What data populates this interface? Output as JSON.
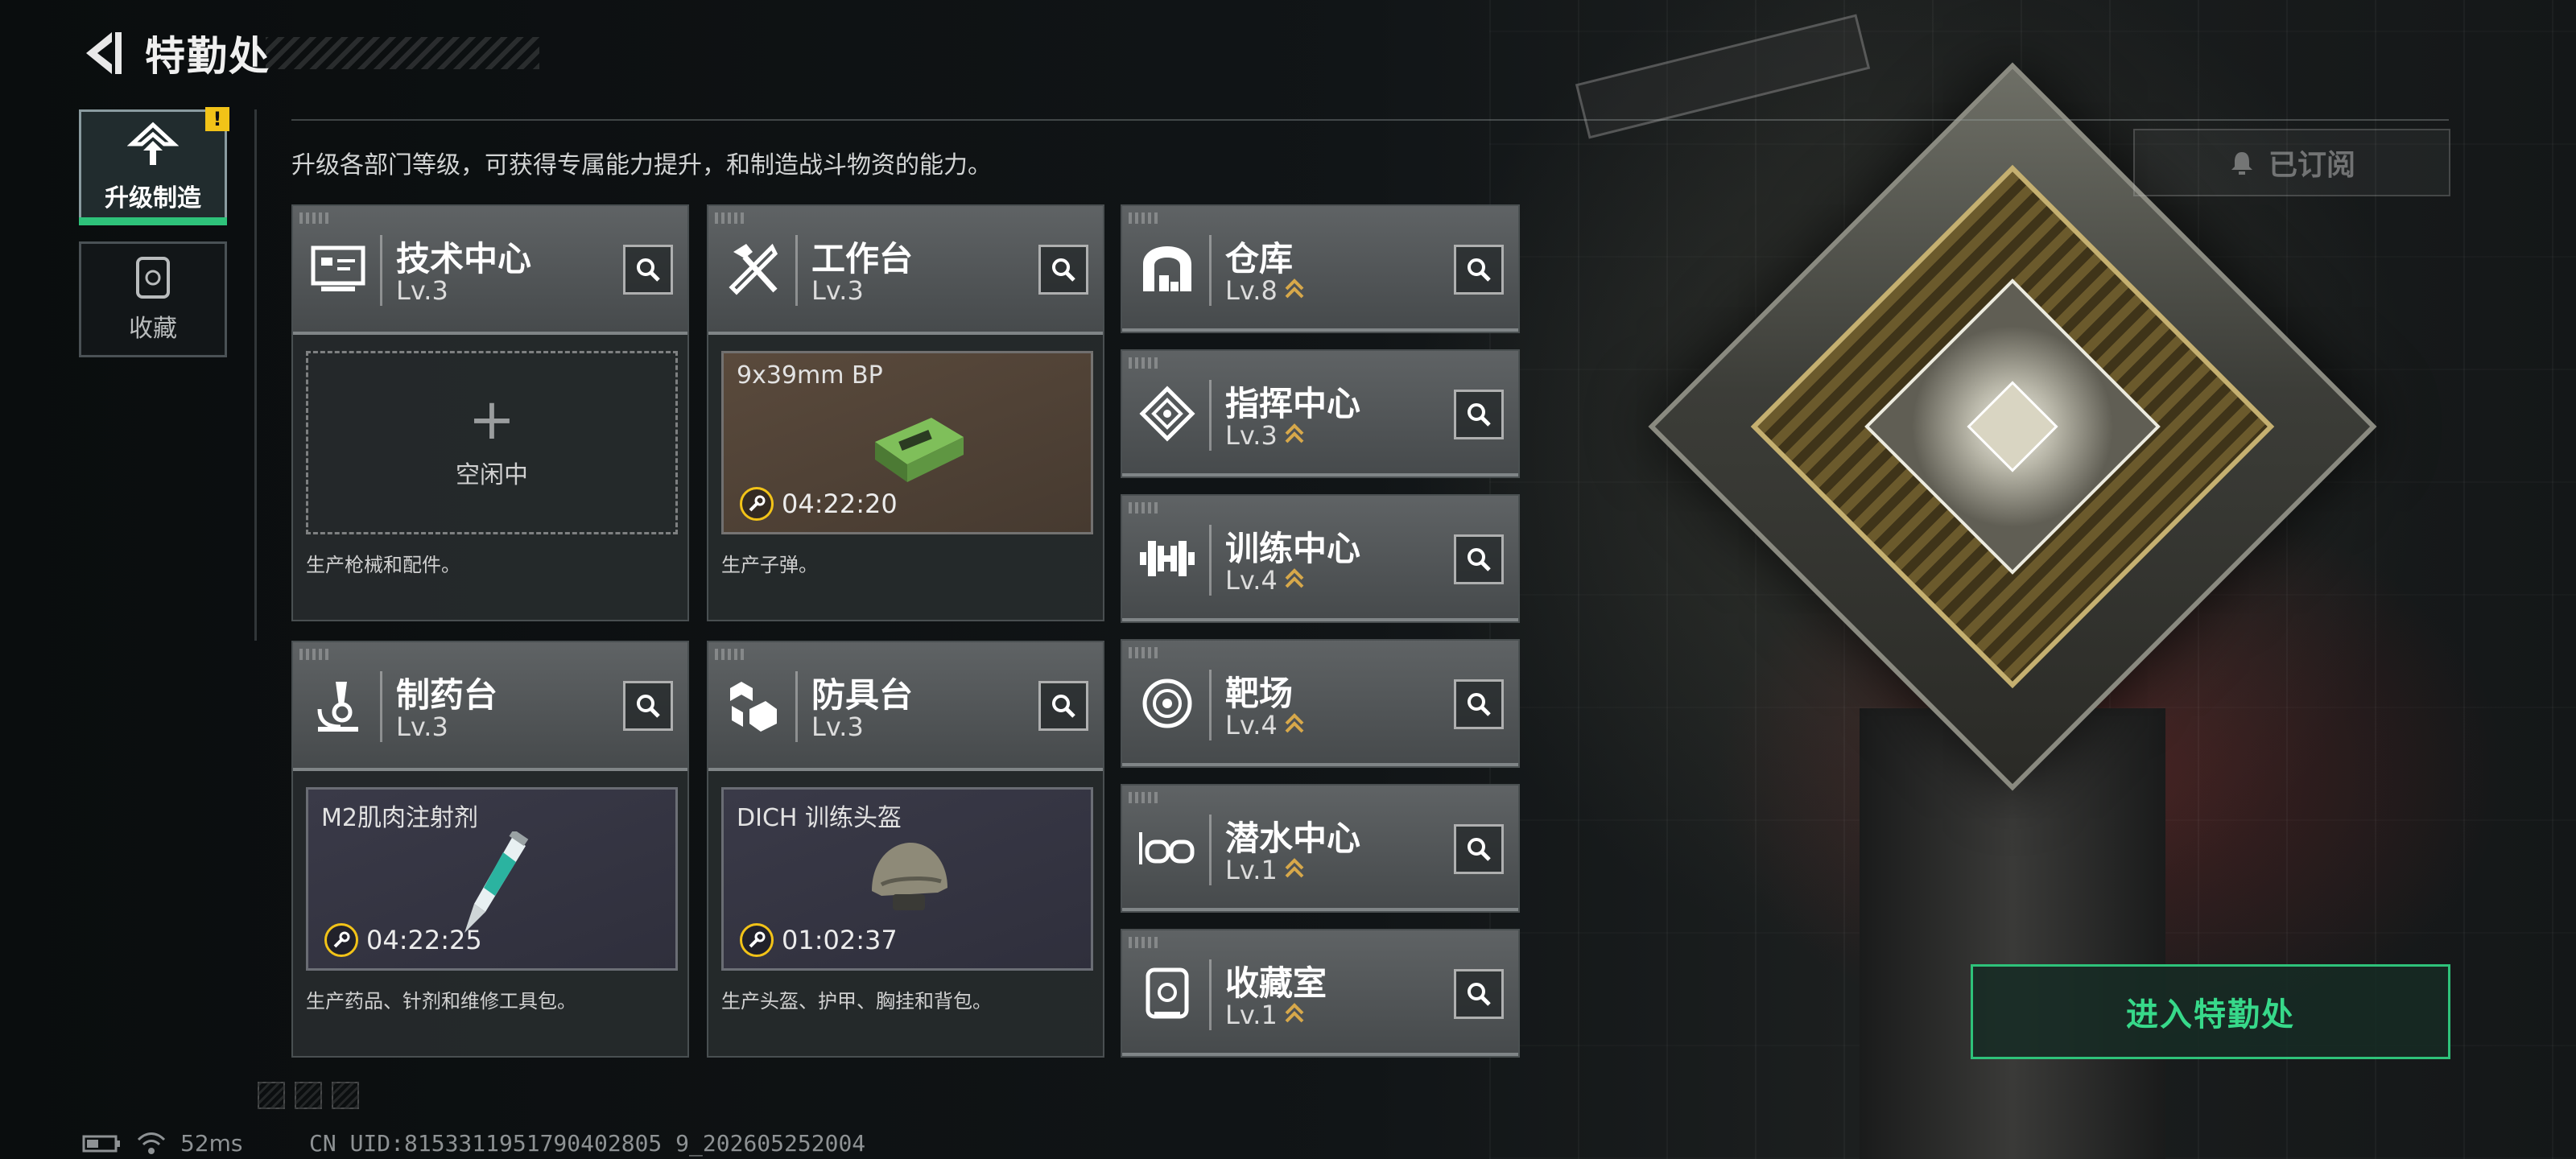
{
  "header": {
    "title": "特勤处"
  },
  "nav": [
    {
      "label": "升级制造",
      "active": true,
      "badge": "!"
    },
    {
      "label": "收藏",
      "active": false
    }
  ],
  "description": "升级各部门等级，可获得专属能力提升，和制造战斗物资的能力。",
  "subscribe": {
    "label": "已订阅"
  },
  "production_cards": [
    {
      "name": "技术中心",
      "level": "Lv.3",
      "status": "idle",
      "idle_text": "空闲中",
      "desc": "生产枪械和配件。"
    },
    {
      "name": "工作台",
      "level": "Lv.3",
      "item": "9x39mm BP",
      "timer": "04:22:20",
      "desc": "生产子弹。"
    },
    {
      "name": "制药台",
      "level": "Lv.3",
      "item": "M2肌肉注射剂",
      "timer": "04:22:25",
      "desc": "生产药品、针剂和维修工具包。"
    },
    {
      "name": "防具台",
      "level": "Lv.3",
      "item": "DICH 训练头盔",
      "timer": "01:02:37",
      "desc": "生产头盔、护甲、胸挂和背包。"
    }
  ],
  "side_cards": [
    {
      "name": "仓库",
      "level": "Lv.8",
      "upgradable": true,
      "icon": "warehouse-icon"
    },
    {
      "name": "指挥中心",
      "level": "Lv.3",
      "upgradable": true,
      "icon": "command-icon"
    },
    {
      "name": "训练中心",
      "level": "Lv.4",
      "upgradable": true,
      "icon": "dumbbell-icon"
    },
    {
      "name": "靶场",
      "level": "Lv.4",
      "upgradable": true,
      "icon": "target-icon"
    },
    {
      "name": "潜水中心",
      "level": "Lv.1",
      "upgradable": true,
      "icon": "goggles-icon"
    },
    {
      "name": "收藏室",
      "level": "Lv.1",
      "upgradable": true,
      "icon": "vault-icon"
    }
  ],
  "enter_button": {
    "label": "进入特勤处"
  },
  "status_bar": {
    "ping": "52ms",
    "uid": "CN UID:8153311951790402805 9_202605252004"
  },
  "colors": {
    "accent": "#2ec27a",
    "warning": "#f2c318"
  }
}
